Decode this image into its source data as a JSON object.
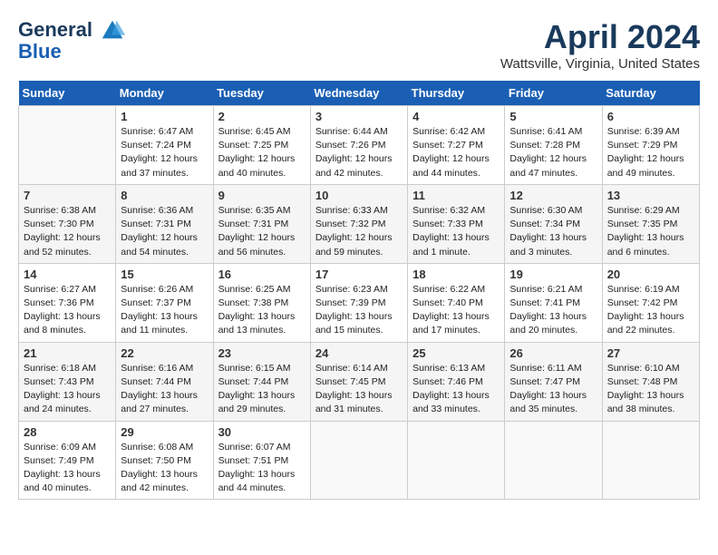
{
  "header": {
    "logo_line1": "General",
    "logo_line2": "Blue",
    "month_title": "April 2024",
    "location": "Wattsville, Virginia, United States"
  },
  "weekdays": [
    "Sunday",
    "Monday",
    "Tuesday",
    "Wednesday",
    "Thursday",
    "Friday",
    "Saturday"
  ],
  "weeks": [
    [
      {
        "day": "",
        "sunrise": "",
        "sunset": "",
        "daylight": ""
      },
      {
        "day": "1",
        "sunrise": "Sunrise: 6:47 AM",
        "sunset": "Sunset: 7:24 PM",
        "daylight": "Daylight: 12 hours and 37 minutes."
      },
      {
        "day": "2",
        "sunrise": "Sunrise: 6:45 AM",
        "sunset": "Sunset: 7:25 PM",
        "daylight": "Daylight: 12 hours and 40 minutes."
      },
      {
        "day": "3",
        "sunrise": "Sunrise: 6:44 AM",
        "sunset": "Sunset: 7:26 PM",
        "daylight": "Daylight: 12 hours and 42 minutes."
      },
      {
        "day": "4",
        "sunrise": "Sunrise: 6:42 AM",
        "sunset": "Sunset: 7:27 PM",
        "daylight": "Daylight: 12 hours and 44 minutes."
      },
      {
        "day": "5",
        "sunrise": "Sunrise: 6:41 AM",
        "sunset": "Sunset: 7:28 PM",
        "daylight": "Daylight: 12 hours and 47 minutes."
      },
      {
        "day": "6",
        "sunrise": "Sunrise: 6:39 AM",
        "sunset": "Sunset: 7:29 PM",
        "daylight": "Daylight: 12 hours and 49 minutes."
      }
    ],
    [
      {
        "day": "7",
        "sunrise": "Sunrise: 6:38 AM",
        "sunset": "Sunset: 7:30 PM",
        "daylight": "Daylight: 12 hours and 52 minutes."
      },
      {
        "day": "8",
        "sunrise": "Sunrise: 6:36 AM",
        "sunset": "Sunset: 7:31 PM",
        "daylight": "Daylight: 12 hours and 54 minutes."
      },
      {
        "day": "9",
        "sunrise": "Sunrise: 6:35 AM",
        "sunset": "Sunset: 7:31 PM",
        "daylight": "Daylight: 12 hours and 56 minutes."
      },
      {
        "day": "10",
        "sunrise": "Sunrise: 6:33 AM",
        "sunset": "Sunset: 7:32 PM",
        "daylight": "Daylight: 12 hours and 59 minutes."
      },
      {
        "day": "11",
        "sunrise": "Sunrise: 6:32 AM",
        "sunset": "Sunset: 7:33 PM",
        "daylight": "Daylight: 13 hours and 1 minute."
      },
      {
        "day": "12",
        "sunrise": "Sunrise: 6:30 AM",
        "sunset": "Sunset: 7:34 PM",
        "daylight": "Daylight: 13 hours and 3 minutes."
      },
      {
        "day": "13",
        "sunrise": "Sunrise: 6:29 AM",
        "sunset": "Sunset: 7:35 PM",
        "daylight": "Daylight: 13 hours and 6 minutes."
      }
    ],
    [
      {
        "day": "14",
        "sunrise": "Sunrise: 6:27 AM",
        "sunset": "Sunset: 7:36 PM",
        "daylight": "Daylight: 13 hours and 8 minutes."
      },
      {
        "day": "15",
        "sunrise": "Sunrise: 6:26 AM",
        "sunset": "Sunset: 7:37 PM",
        "daylight": "Daylight: 13 hours and 11 minutes."
      },
      {
        "day": "16",
        "sunrise": "Sunrise: 6:25 AM",
        "sunset": "Sunset: 7:38 PM",
        "daylight": "Daylight: 13 hours and 13 minutes."
      },
      {
        "day": "17",
        "sunrise": "Sunrise: 6:23 AM",
        "sunset": "Sunset: 7:39 PM",
        "daylight": "Daylight: 13 hours and 15 minutes."
      },
      {
        "day": "18",
        "sunrise": "Sunrise: 6:22 AM",
        "sunset": "Sunset: 7:40 PM",
        "daylight": "Daylight: 13 hours and 17 minutes."
      },
      {
        "day": "19",
        "sunrise": "Sunrise: 6:21 AM",
        "sunset": "Sunset: 7:41 PM",
        "daylight": "Daylight: 13 hours and 20 minutes."
      },
      {
        "day": "20",
        "sunrise": "Sunrise: 6:19 AM",
        "sunset": "Sunset: 7:42 PM",
        "daylight": "Daylight: 13 hours and 22 minutes."
      }
    ],
    [
      {
        "day": "21",
        "sunrise": "Sunrise: 6:18 AM",
        "sunset": "Sunset: 7:43 PM",
        "daylight": "Daylight: 13 hours and 24 minutes."
      },
      {
        "day": "22",
        "sunrise": "Sunrise: 6:16 AM",
        "sunset": "Sunset: 7:44 PM",
        "daylight": "Daylight: 13 hours and 27 minutes."
      },
      {
        "day": "23",
        "sunrise": "Sunrise: 6:15 AM",
        "sunset": "Sunset: 7:44 PM",
        "daylight": "Daylight: 13 hours and 29 minutes."
      },
      {
        "day": "24",
        "sunrise": "Sunrise: 6:14 AM",
        "sunset": "Sunset: 7:45 PM",
        "daylight": "Daylight: 13 hours and 31 minutes."
      },
      {
        "day": "25",
        "sunrise": "Sunrise: 6:13 AM",
        "sunset": "Sunset: 7:46 PM",
        "daylight": "Daylight: 13 hours and 33 minutes."
      },
      {
        "day": "26",
        "sunrise": "Sunrise: 6:11 AM",
        "sunset": "Sunset: 7:47 PM",
        "daylight": "Daylight: 13 hours and 35 minutes."
      },
      {
        "day": "27",
        "sunrise": "Sunrise: 6:10 AM",
        "sunset": "Sunset: 7:48 PM",
        "daylight": "Daylight: 13 hours and 38 minutes."
      }
    ],
    [
      {
        "day": "28",
        "sunrise": "Sunrise: 6:09 AM",
        "sunset": "Sunset: 7:49 PM",
        "daylight": "Daylight: 13 hours and 40 minutes."
      },
      {
        "day": "29",
        "sunrise": "Sunrise: 6:08 AM",
        "sunset": "Sunset: 7:50 PM",
        "daylight": "Daylight: 13 hours and 42 minutes."
      },
      {
        "day": "30",
        "sunrise": "Sunrise: 6:07 AM",
        "sunset": "Sunset: 7:51 PM",
        "daylight": "Daylight: 13 hours and 44 minutes."
      },
      {
        "day": "",
        "sunrise": "",
        "sunset": "",
        "daylight": ""
      },
      {
        "day": "",
        "sunrise": "",
        "sunset": "",
        "daylight": ""
      },
      {
        "day": "",
        "sunrise": "",
        "sunset": "",
        "daylight": ""
      },
      {
        "day": "",
        "sunrise": "",
        "sunset": "",
        "daylight": ""
      }
    ]
  ]
}
